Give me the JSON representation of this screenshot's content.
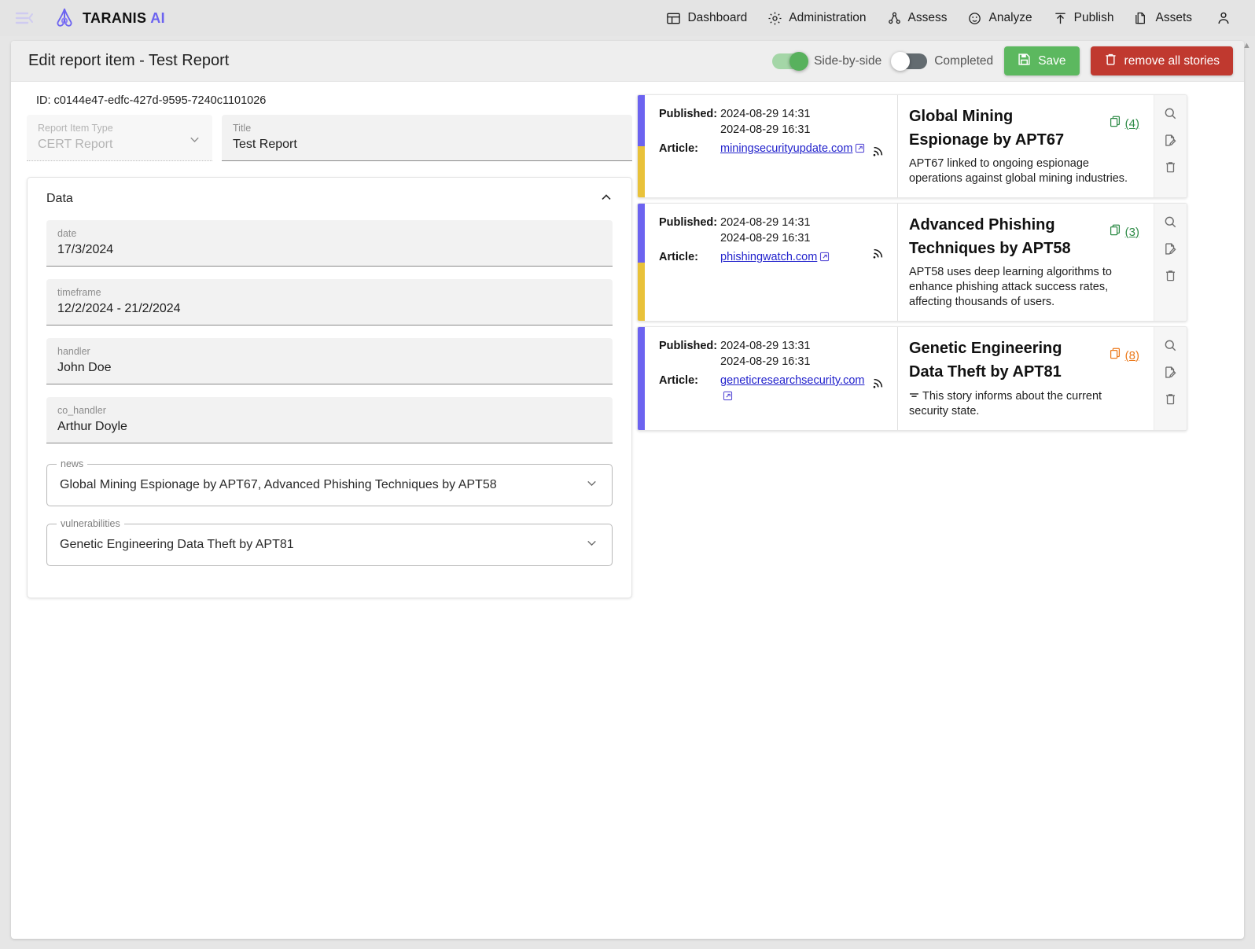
{
  "app": {
    "brand_name": "TARANIS",
    "brand_suffix": "AI",
    "menu_icon": "hamburger-collapse-icon"
  },
  "nav": {
    "items": [
      {
        "label": "Dashboard",
        "icon": "dashboard-icon"
      },
      {
        "label": "Administration",
        "icon": "gear-icon"
      },
      {
        "label": "Assess",
        "icon": "assess-nodes-icon"
      },
      {
        "label": "Analyze",
        "icon": "analyze-target-icon"
      },
      {
        "label": "Publish",
        "icon": "publish-upload-icon"
      },
      {
        "label": "Assets",
        "icon": "assets-documents-icon"
      }
    ],
    "account_icon": "user-account-icon"
  },
  "toolbar": {
    "title": "Edit report item - Test Report",
    "side_by_side_label": "Side-by-side",
    "side_by_side_on": true,
    "completed_label": "Completed",
    "completed_on": false,
    "save_label": "Save",
    "save_icon": "save-disk-icon",
    "remove_label": "remove all stories",
    "remove_icon": "trash-icon",
    "save_color": "#5cb85f",
    "remove_color": "#c0392f"
  },
  "form": {
    "id_line": "ID: c0144e47-edfc-427d-9595-7240c1101026",
    "report_item_type": {
      "label": "Report Item Type",
      "value": "CERT Report",
      "disabled": true
    },
    "title_field": {
      "label": "Title",
      "value": "Test Report"
    },
    "data_section": {
      "heading": "Data",
      "collapse_icon": "chevron-up-icon"
    },
    "fields": [
      {
        "label": "date",
        "value": "17/3/2024"
      },
      {
        "label": "timeframe",
        "value": "12/2/2024 - 21/2/2024"
      },
      {
        "label": "handler",
        "value": "John Doe"
      },
      {
        "label": "co_handler",
        "value": "Arthur Doyle"
      }
    ],
    "selects": [
      {
        "label": "news",
        "value": "Global Mining Espionage by APT67, Advanced Phishing Techniques by APT58"
      },
      {
        "label": "vulnerabilities",
        "value": "Genetic Engineering Data Theft by APT81"
      }
    ]
  },
  "stories": {
    "published_label": "Published:",
    "article_label": "Article:",
    "actions": [
      {
        "name": "search-icon"
      },
      {
        "name": "file-edit-icon"
      },
      {
        "name": "trash-icon"
      }
    ],
    "items": [
      {
        "published_1": "2024-08-29 14:31",
        "published_2": "2024-08-29 16:31",
        "link": "miningsecurityupdate.com",
        "title": "Global Mining Espionage by APT67",
        "description": "APT67 linked to ongoing espionage operations against global mining industries.",
        "count": "(4)",
        "count_color": "#2e8b47",
        "bar_top": "#6c63f0",
        "bar_bottom": "#e9c23a",
        "has_summary_icon": false
      },
      {
        "published_1": "2024-08-29 14:31",
        "published_2": "2024-08-29 16:31",
        "link": "phishingwatch.com",
        "title": "Advanced Phishing Techniques by APT58",
        "description": "APT58 uses deep learning algorithms to enhance phishing attack success rates, affecting thousands of users.",
        "count": "(3)",
        "count_color": "#2e8b47",
        "bar_top": "#6c63f0",
        "bar_bottom": "#e9c23a",
        "has_summary_icon": false
      },
      {
        "published_1": "2024-08-29 13:31",
        "published_2": "2024-08-29 16:31",
        "link": "geneticresearchsecurity.com",
        "title": "Genetic Engineering Data Theft by APT81",
        "description": "This story informs about the current security state.",
        "count": "(8)",
        "count_color": "#ec7a1c",
        "bar_top": "#6c63f0",
        "bar_bottom": "#6c63f0",
        "has_summary_icon": true
      }
    ]
  }
}
